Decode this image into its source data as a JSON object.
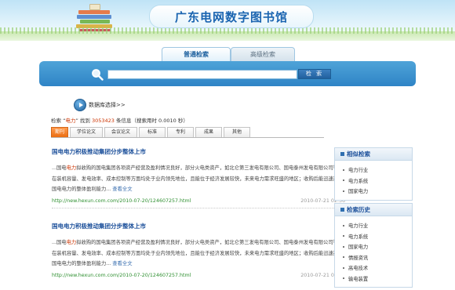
{
  "header": {
    "title": "广东电网数字图书馆"
  },
  "search": {
    "tabs": [
      {
        "label": "普通检索",
        "active": true
      },
      {
        "label": "高级检索",
        "active": false
      }
    ],
    "query": "",
    "button_label": "检 索"
  },
  "db_select": {
    "label": "数据库选择>>"
  },
  "result_info": {
    "prefix": "检索 “",
    "keyword": "电力",
    "mid": "” 找到 ",
    "count": "3053423",
    "suffix": " 条信息（搜索用时 0.0010 秒）"
  },
  "categories": [
    {
      "label": "期刊",
      "active": true
    },
    {
      "label": "学位论文",
      "active": false
    },
    {
      "label": "会议论文",
      "active": false
    },
    {
      "label": "标准",
      "active": false
    },
    {
      "label": "专利",
      "active": false
    },
    {
      "label": "成果",
      "active": false
    },
    {
      "label": "其他",
      "active": false
    }
  ],
  "results": [
    {
      "title": "国电电力积极推动集团分步整体上市",
      "snippet_pre": "...国电",
      "snippet_hl": "电力",
      "snippet_post": "拟收购的国电集团各项资产经营及盈利情况良好，部分火电类资产，如北仑第三发电有限公司、国电泰州发电有限公司等，在装机容量、发电效率、成本控制等方面均处于业内领先地位，且能位于经济发展较快，未来电力需求旺盛的地区；收购后能迅速提升国电电力的整体盈利能力...",
      "more_label": "查看全文",
      "url": "http://new.hexun.com.com/2010-07-20/124607257.html",
      "date": "2010-07-21 02:36"
    },
    {
      "title": "国电电力积极推动集团分步整体上市",
      "snippet_pre": "...国电",
      "snippet_hl": "电力",
      "snippet_post": "拟收购的国电集团各项资产经营及盈利情况良好，部分火电类资产，如北仑第三发电有限公司、国电泰州发电有限公司等，在装机容量、发电效率、成本控制等方面均处于业内领先地位，且能位于经济发展较快，未来电力需求旺盛的地区；收购后能迅速提升国电电力的整体盈利能力...",
      "more_label": "查看全文",
      "url": "http://new.hexun.com.com/2010-07-20/124607257.html",
      "date": "2010-07-21 02:36"
    }
  ],
  "related": {
    "title": "相似检索",
    "items": [
      "电力行业",
      "电力系统",
      "国家电力"
    ]
  },
  "history": {
    "title": "检索历史",
    "items": [
      "电力行业",
      "电力系统",
      "国家电力",
      "情报资讯",
      "高电技术",
      "输电装置"
    ]
  }
}
